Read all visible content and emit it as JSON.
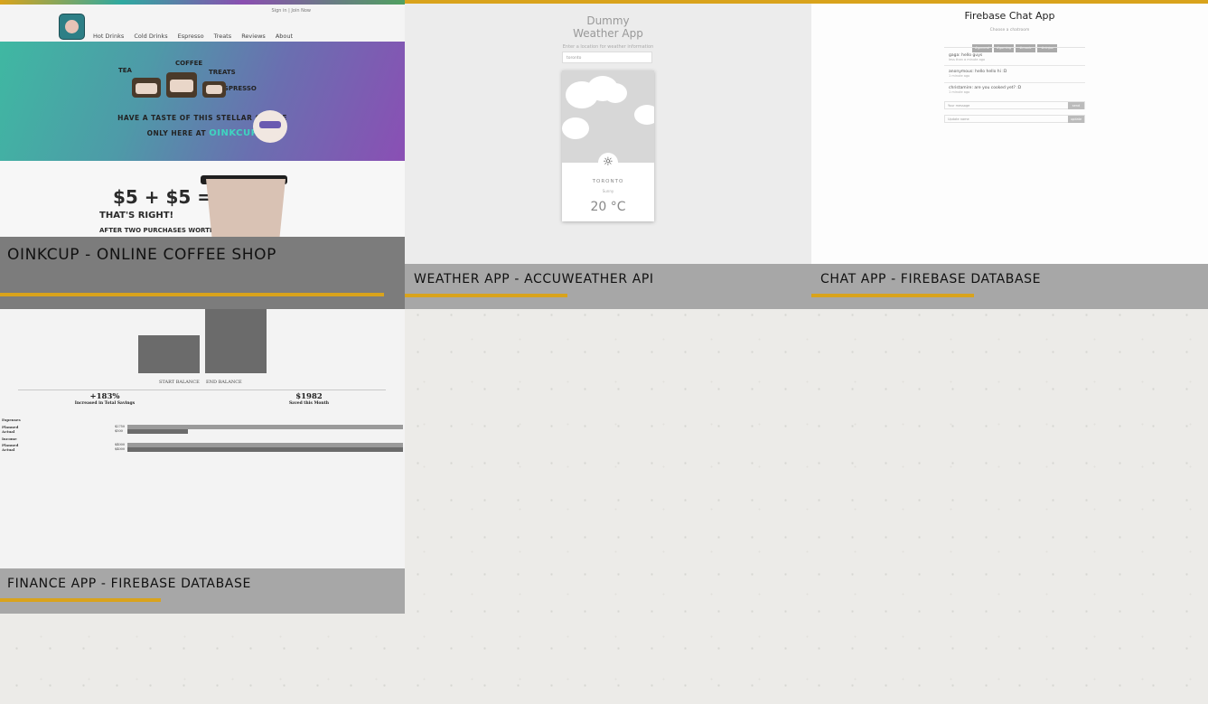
{
  "theme": {
    "accent": "#d9a31c",
    "caption_dark": "#7c7c7c",
    "caption_light": "#a7a7a7"
  },
  "projects": [
    {
      "title": "OINKCUP - ONLINE COFFEE SHOP",
      "preview": {
        "header_links": "Sign in  |  Join Now",
        "nav": [
          "Hot Drinks",
          "Cold Drinks",
          "Espresso",
          "Treats",
          "Reviews",
          "About"
        ],
        "hero_labels": [
          "TEA",
          "COFFEE",
          "TREATS",
          "ESPRESSO"
        ],
        "hero_tagline": "HAVE A TASTE OF THIS STELLAR COFFEE",
        "hero_tagline_2": "ONLY HERE AT",
        "brand": "OINKCUP",
        "promo_big": "$5 + $5 =",
        "promo_mid": "THAT'S RIGHT!",
        "promo_small": "AFTER TWO PURCHASES WORTH"
      }
    },
    {
      "title": "WEATHER APP - ACCUWEATHER API",
      "preview": {
        "app_title_line1": "Dummy",
        "app_title_line2": "Weather App",
        "subtitle": "Enter a location for weather information",
        "input_value": "toronto",
        "city": "TORONTO",
        "condition": "Sunny",
        "temperature": "20 °C",
        "icon": "sun-icon"
      }
    },
    {
      "title": "CHAT APP - FIREBASE DATABASE",
      "preview": {
        "app_title": "Firebase Chat App",
        "subtitle": "Choose a chatroom",
        "rooms": [
          "#general",
          "#gaming",
          "#music",
          "#ninjas"
        ],
        "messages": [
          {
            "text": "gaga: hello guys",
            "meta": "less than a minute ago"
          },
          {
            "text": "anonymous: hello hello hi :D",
            "meta": "1 minute ago"
          },
          {
            "text": "christamire: are you cooked yet? :D",
            "meta": "1 minute ago"
          }
        ],
        "message_placeholder": "Your message",
        "message_button": "send",
        "name_placeholder": "Update name",
        "name_button": "update"
      }
    },
    {
      "title": "FINANCE APP - FIREBASE DATABASE",
      "preview": {
        "bar_labels": [
          "START BALANCE",
          "END BALANCE"
        ],
        "stat1_value": "+183%",
        "stat1_label": "Increased in Total Savings",
        "stat2_value": "$1982",
        "stat2_label": "Saved this Month",
        "rows": [
          {
            "label": "Expenses",
            "fill": null
          },
          {
            "label": "Planned",
            "value": "$2750",
            "fill": 1.0
          },
          {
            "label": "Actual",
            "value": "$500",
            "fill": 0.22
          },
          {
            "label": "Income",
            "fill": null
          },
          {
            "label": "Planned",
            "value": "$4000",
            "fill": 1.0
          },
          {
            "label": "Actual",
            "value": "$4000",
            "fill": 1.0
          }
        ]
      }
    }
  ]
}
